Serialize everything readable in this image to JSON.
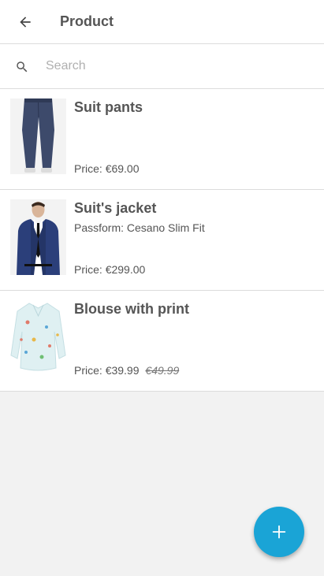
{
  "header": {
    "title": "Product"
  },
  "search": {
    "placeholder": "Search",
    "value": ""
  },
  "products": [
    {
      "name": "Suit pants",
      "subtitle": "",
      "price_label": "Price:",
      "price": "€69.00",
      "old_price": ""
    },
    {
      "name": "Suit's jacket",
      "subtitle": "Passform: Cesano Slim Fit",
      "price_label": "Price:",
      "price": "€299.00",
      "old_price": ""
    },
    {
      "name": "Blouse with print",
      "subtitle": "",
      "price_label": "Price:",
      "price": "€39.99",
      "old_price": "€49.99"
    }
  ],
  "colors": {
    "accent": "#1aa4d6",
    "background": "#f2f2f2",
    "text": "#555555"
  },
  "icons": {
    "back": "arrow-left-icon",
    "search": "search-icon",
    "fab": "plus-icon"
  }
}
